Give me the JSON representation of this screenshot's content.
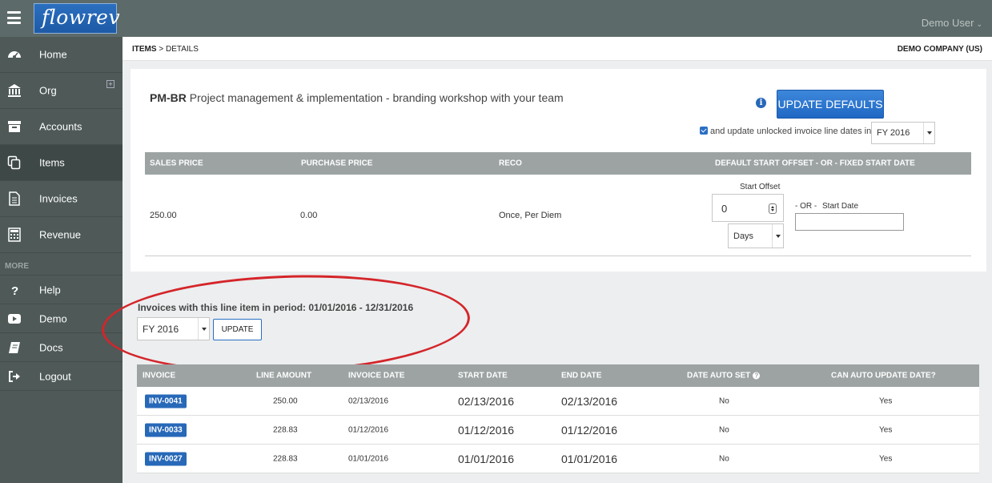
{
  "app": {
    "brand": "flowrev",
    "user": "Demo User"
  },
  "sidebar": {
    "main_items": [
      {
        "label": "Home",
        "icon": "dashboard-icon"
      },
      {
        "label": "Org",
        "icon": "bank-icon"
      },
      {
        "label": "Accounts",
        "icon": "archive-icon"
      },
      {
        "label": "Items",
        "icon": "copy-icon"
      },
      {
        "label": "Invoices",
        "icon": "document-icon"
      },
      {
        "label": "Revenue",
        "icon": "calculator-icon"
      }
    ],
    "more_label": "MORE",
    "more_items": [
      {
        "label": "Help",
        "icon": "question-icon"
      },
      {
        "label": "Demo",
        "icon": "video-play-icon"
      },
      {
        "label": "Docs",
        "icon": "book-icon"
      },
      {
        "label": "Logout",
        "icon": "logout-icon"
      }
    ]
  },
  "breadcrumb": {
    "parent": "ITEMS",
    "separator": ">",
    "current": "DETAILS"
  },
  "company": "DEMO COMPANY (US)",
  "item": {
    "code": "PM-BR",
    "description": "Project management & implementation - branding workshop with your team",
    "update_defaults_label": "UPDATE DEFAULTS",
    "update_unlocked_label": "and update unlocked invoice line dates in",
    "update_unlocked_checked": true,
    "period_select": "FY 2016",
    "columns": [
      "SALES PRICE",
      "PURCHASE PRICE",
      "RECO",
      "DEFAULT START OFFSET - OR - FIXED START DATE"
    ],
    "sales_price": "250.00",
    "purchase_price": "0.00",
    "reco": "Once, Per Diem",
    "start_offset_label": "Start Offset",
    "start_offset_value": "0",
    "offset_unit": "Days",
    "or_label": "- OR -",
    "start_date_label": "Start Date",
    "start_date_value": ""
  },
  "invoices": {
    "period_title": "Invoices with this line item in period: 01/01/2016 - 12/31/2016",
    "period_select": "FY 2016",
    "update_label": "UPDATE",
    "columns": [
      "INVOICE",
      "LINE AMOUNT",
      "INVOICE DATE",
      "START DATE",
      "END DATE",
      "DATE AUTO SET",
      "CAN AUTO UPDATE DATE?"
    ],
    "rows": [
      {
        "invoice": "INV-0041",
        "amount": "250.00",
        "invoice_date": "02/13/2016",
        "start": "02/13/2016",
        "end": "02/13/2016",
        "auto_set": "No",
        "can_update": "Yes"
      },
      {
        "invoice": "INV-0033",
        "amount": "228.83",
        "invoice_date": "01/12/2016",
        "start": "01/12/2016",
        "end": "01/12/2016",
        "auto_set": "No",
        "can_update": "Yes"
      },
      {
        "invoice": "INV-0027",
        "amount": "228.83",
        "invoice_date": "01/01/2016",
        "start": "01/01/2016",
        "end": "01/01/2016",
        "auto_set": "No",
        "can_update": "Yes"
      }
    ]
  },
  "colors": {
    "accent": "#2768b8",
    "sidebar": "#4e5958",
    "topbar": "#5c6b69",
    "annotation": "#d4252a"
  }
}
